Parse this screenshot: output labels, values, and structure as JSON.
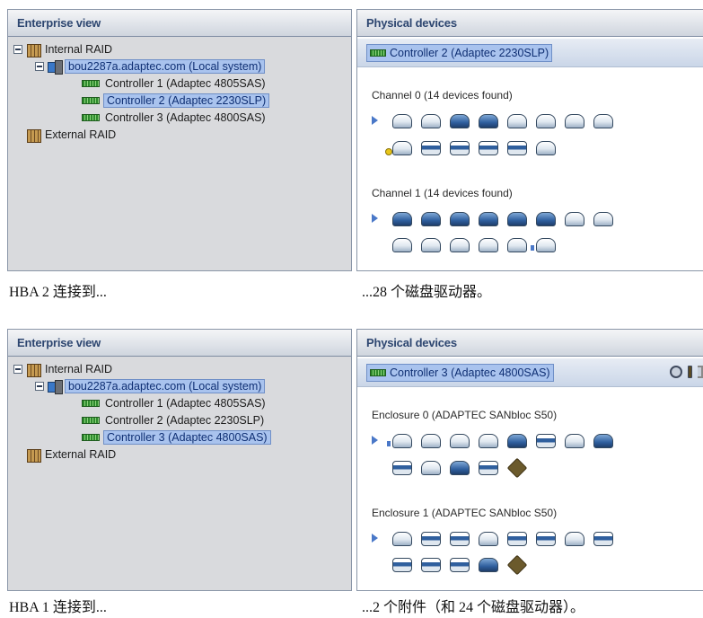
{
  "top": {
    "enterprise_header": "Enterprise view",
    "physical_header": "Physical devices",
    "tree": {
      "internal_raid": "Internal RAID",
      "system": "bou2287a.adaptec.com (Local system)",
      "controller1": "Controller 1 (Adaptec 4805SAS)",
      "controller2": "Controller 2 (Adaptec 2230SLP)",
      "controller3": "Controller 3 (Adaptec 4800SAS)",
      "external_raid": "External RAID"
    },
    "selected_controller": "Controller 2 (Adaptec 2230SLP)",
    "group1_label": "Channel 0   (14 devices found)",
    "group2_label": "Channel 1   (14 devices found)",
    "caption_left": "HBA 2 连接到...",
    "caption_right": "...28 个磁盘驱动器。"
  },
  "bottom": {
    "enterprise_header": "Enterprise view",
    "physical_header": "Physical devices",
    "tree": {
      "internal_raid": "Internal RAID",
      "system": "bou2287a.adaptec.com (Local system)",
      "controller1": "Controller 1 (Adaptec 4805SAS)",
      "controller2": "Controller 2 (Adaptec 2230SLP)",
      "controller3": "Controller 3 (Adaptec 4800SAS)",
      "external_raid": "External RAID"
    },
    "selected_controller": "Controller 3 (Adaptec 4800SAS)",
    "group1_label": "Enclosure 0 (ADAPTEC SANbloc S50)",
    "group2_label": "Enclosure 1 (ADAPTEC SANbloc S50)",
    "caption_left": "HBA 1 连接到...",
    "caption_right": "...2 个附件（和 24 个磁盘驱动器）。"
  },
  "icons": {
    "tree_expander": "minus-box-icon",
    "raid_group": "building-icon",
    "system": "computer-icon",
    "controller": "controller-card-icon",
    "disk": "disk-drive-icon",
    "enclosure": "enclosure-icon",
    "row_arrow": "play-arrow-icon"
  }
}
